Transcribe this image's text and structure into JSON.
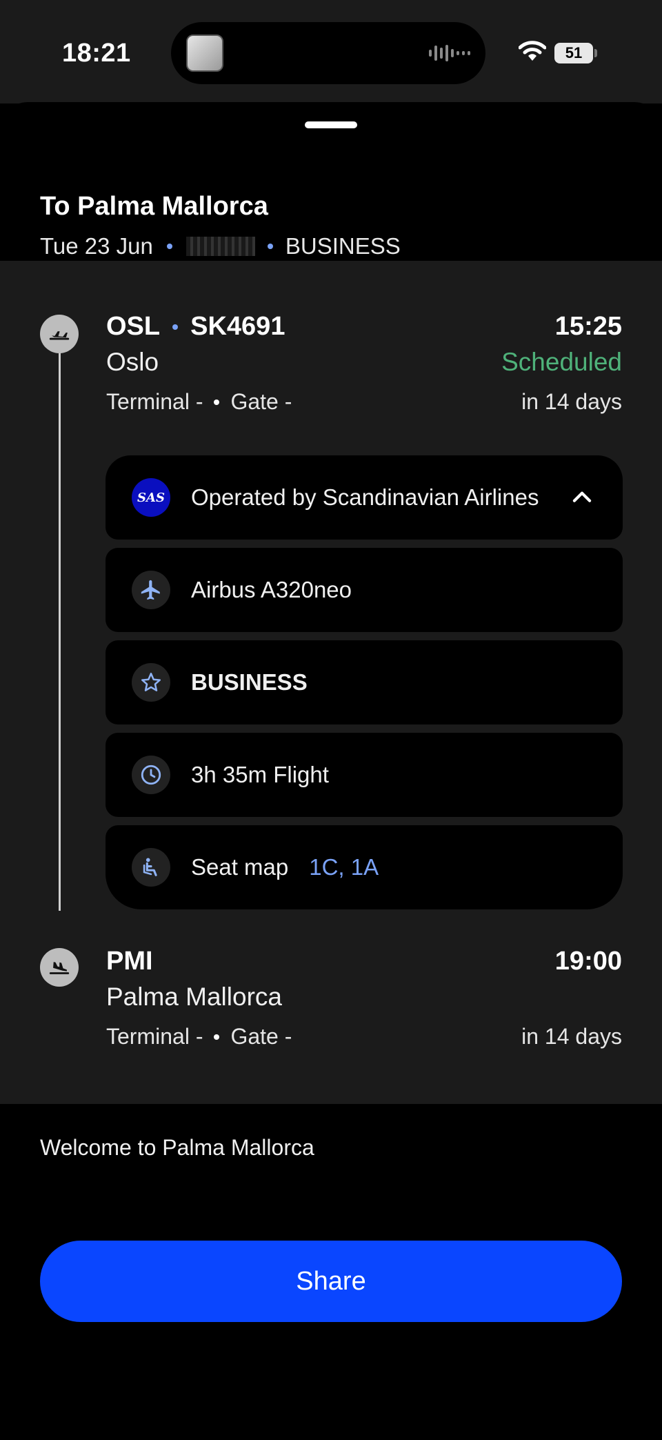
{
  "status_bar": {
    "time": "18:21",
    "battery": "51"
  },
  "header": {
    "title": "To Palma Mallorca",
    "date": "Tue 23 Jun",
    "cabin": "BUSINESS"
  },
  "departure": {
    "code": "OSL",
    "flight_number": "SK4691",
    "city": "Oslo",
    "terminal": "Terminal -",
    "gate": "Gate -",
    "time": "15:25",
    "status": "Scheduled",
    "relative": "in 14 days"
  },
  "details": {
    "operator": "Operated by Scandinavian Airlines",
    "operator_logo": "SAS",
    "aircraft": "Airbus A320neo",
    "cabin": "BUSINESS",
    "duration": "3h 35m Flight",
    "seat_map_label": "Seat map",
    "seats": "1C, 1A"
  },
  "arrival": {
    "code": "PMI",
    "city": "Palma Mallorca",
    "terminal": "Terminal -",
    "gate": "Gate -",
    "time": "19:00",
    "relative": "in 14 days"
  },
  "welcome_text": "Welcome to Palma Mallorca",
  "share_label": "Share",
  "colors": {
    "accent_blue": "#0a46ff",
    "status_green": "#4fb27a",
    "link_blue": "#7aa2f7",
    "sas_blue": "#0a0fbf"
  }
}
